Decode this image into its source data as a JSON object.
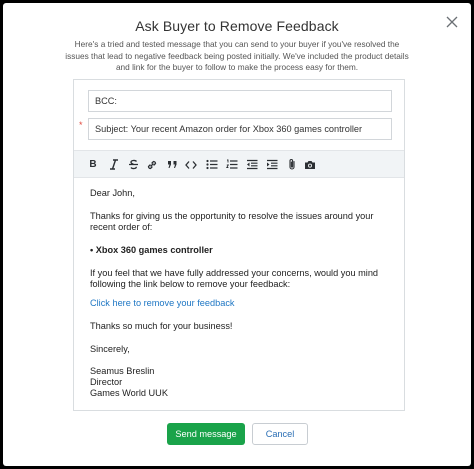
{
  "dialog": {
    "title": "Ask Buyer to Remove Feedback",
    "description": "Here's a tried and tested message that you can send to your buyer if you've resolved the issues that lead to negative feedback being posted initially. We've included the product details and link for the buyer to follow to make the process easy for them."
  },
  "form": {
    "bcc_value": "BCC:",
    "required_marker": "*",
    "subject_value": "Subject:  Your recent Amazon order for Xbox 360 games controller"
  },
  "toolbar": {
    "bold": "B",
    "items": [
      "bold-icon",
      "italic-icon",
      "strikethrough-icon",
      "link-icon",
      "quote-icon",
      "code-icon",
      "bullet-list-icon",
      "numbered-list-icon",
      "outdent-icon",
      "indent-icon",
      "attachment-icon",
      "camera-icon"
    ]
  },
  "message": {
    "greeting": "Dear John,",
    "intro": "Thanks for giving us the opportunity to resolve the issues around your recent order of:",
    "product": "• Xbox 360 games controller",
    "request": "If you feel that we have fully addressed your concerns, would you mind following the link below to remove your feedback:",
    "link_text": "Click here to remove your feedback",
    "thanks": "Thanks so much for your business!",
    "signoff": "Sincerely,",
    "name": "Seamus Breslin",
    "role": "Director",
    "company": "Games World UUK"
  },
  "actions": {
    "send_label": "Send message",
    "cancel_label": "Cancel"
  },
  "colors": {
    "send_button": "#1aa34a",
    "link": "#1f77c4",
    "required": "#e0463b"
  }
}
